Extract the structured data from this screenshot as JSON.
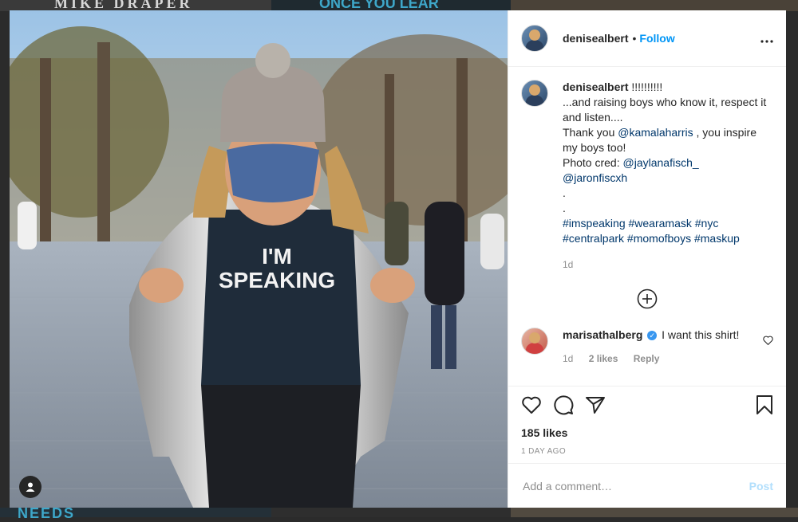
{
  "background": {
    "top_texts": [
      "MIKE DRAPER",
      "ONCE YOU LEAR"
    ],
    "bottom_text": "NEEDS"
  },
  "photo": {
    "shirt_line1": "I'M",
    "shirt_line2": "SPEAKING"
  },
  "header": {
    "username": "denisealbert",
    "separator": "•",
    "follow_label": "Follow",
    "more_icon": "more-horizontal-icon"
  },
  "caption": {
    "username": "denisealbert",
    "line1": "!!!!!!!!!!",
    "line2": "...and raising boys who know it, respect it and listen....",
    "line3_pre": "Thank you ",
    "line3_mention": "@kamalaharris",
    "line3_post": " , you inspire my boys too!",
    "line4_pre": "Photo cred: ",
    "mention2": "@jaylanafisch_",
    "mention3": "@jaronfiscxh",
    "dot1": ".",
    "dot2": ".",
    "hashtags1": "#imspeaking #wearamask #nyc",
    "hashtags2": "#centralpark #momofboys #maskup",
    "time": "1d"
  },
  "load_more_icon": "plus-circle-icon",
  "comment": {
    "username": "marisathalberg",
    "verified_mark": "✓",
    "text": "I want this shirt!",
    "time": "1d",
    "likes": "2 likes",
    "reply": "Reply"
  },
  "actions": {
    "likes": "185 likes",
    "date": "1 DAY AGO"
  },
  "add_comment": {
    "placeholder": "Add a comment…",
    "post_label": "Post"
  },
  "colors": {
    "accent": "#0095f6",
    "post_disabled": "#b2dffc",
    "link": "#00376b",
    "muted": "#8e8e8e"
  }
}
